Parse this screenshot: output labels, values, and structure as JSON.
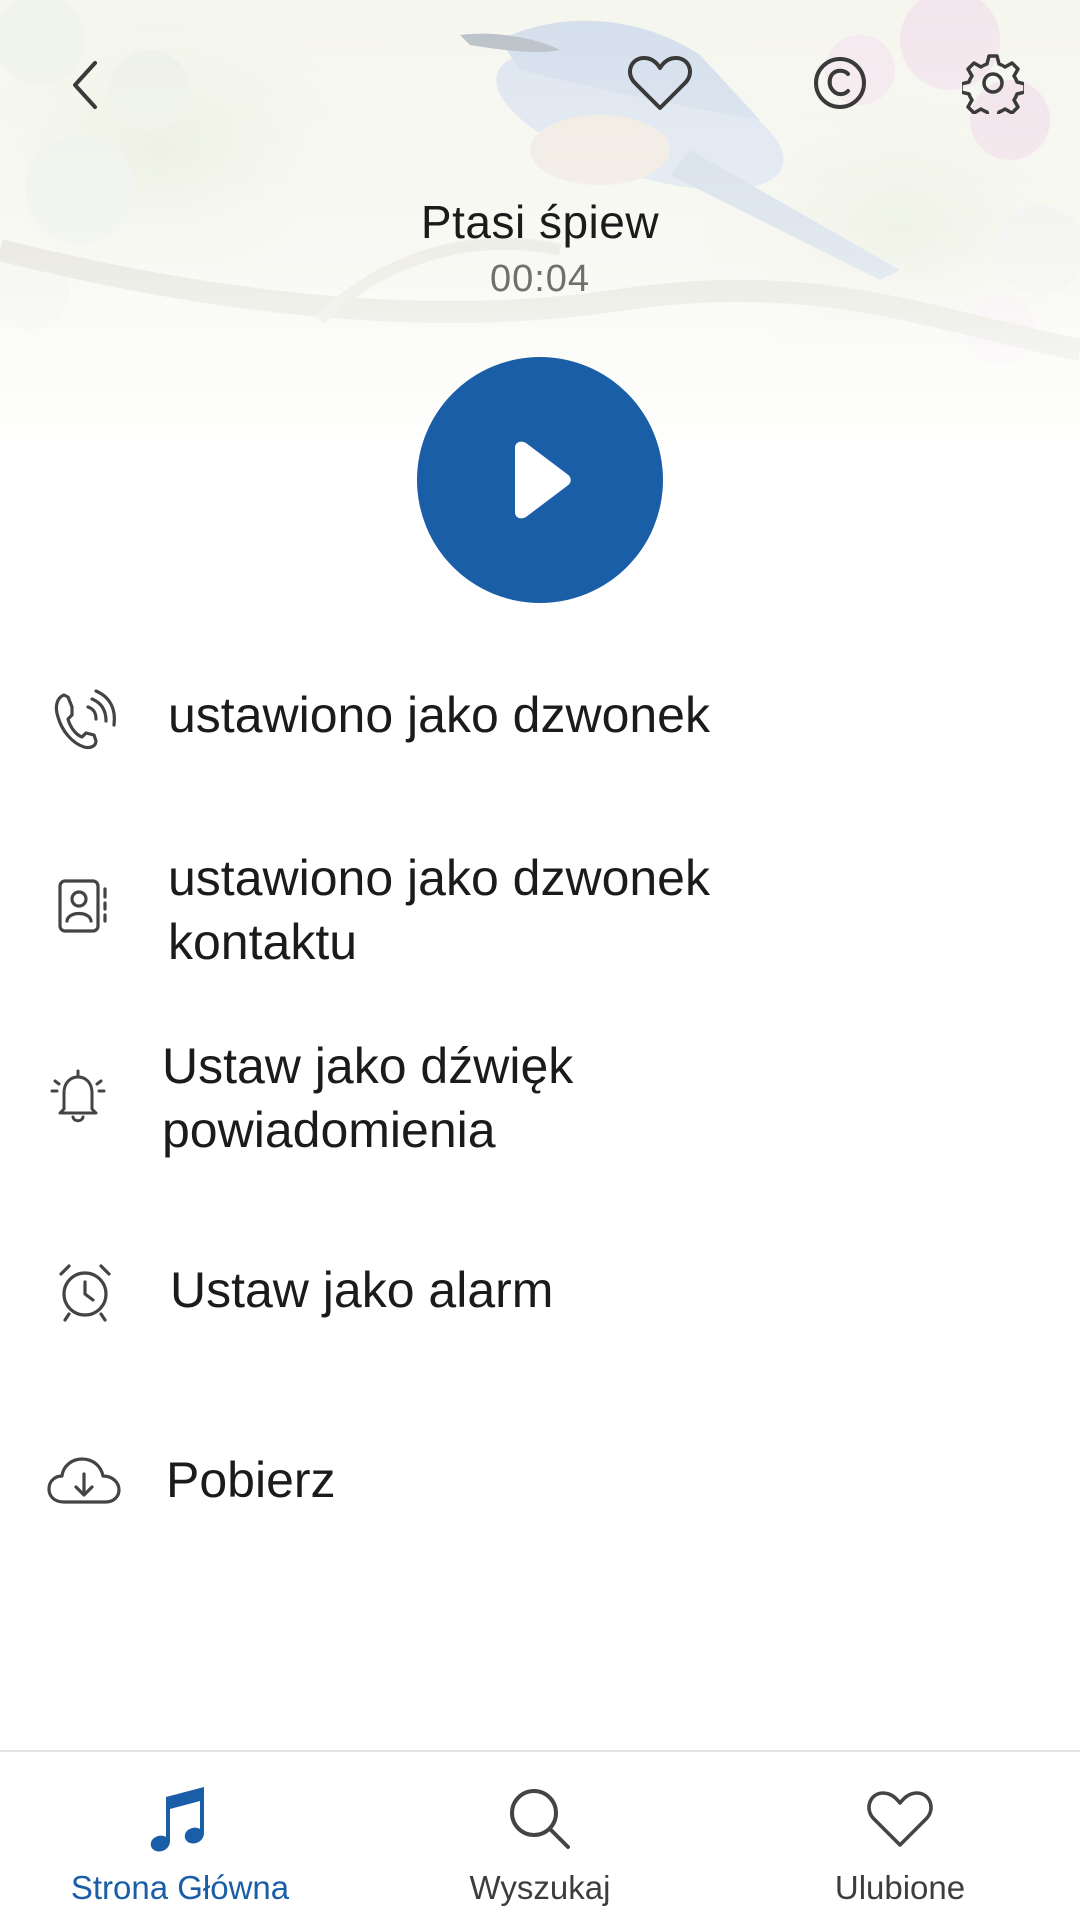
{
  "sound": {
    "title": "Ptasi śpiew",
    "duration": "00:04"
  },
  "header": {
    "icons": [
      "back-icon",
      "heart-icon",
      "copyright-icon",
      "gear-icon"
    ]
  },
  "actions": [
    {
      "label": "ustawiono jako dzwonek",
      "icon": "phone-ringing-icon"
    },
    {
      "label": "ustawiono jako dzwonek kontaktu",
      "icon": "contact-card-icon"
    },
    {
      "label": "Ustaw jako dźwięk powiadomienia",
      "icon": "bell-icon"
    },
    {
      "label": "Ustaw jako alarm",
      "icon": "alarm-clock-icon"
    },
    {
      "label": "Pobierz",
      "icon": "cloud-download-icon"
    }
  ],
  "tabs": [
    {
      "label": "Strona Główna",
      "icon": "music-note-icon",
      "active": true
    },
    {
      "label": "Wyszukaj",
      "icon": "search-icon",
      "active": false
    },
    {
      "label": "Ulubione",
      "icon": "heart-icon",
      "active": false
    }
  ],
  "colors": {
    "accent": "#1a5ea8",
    "text": "#1b1b1b",
    "muted": "#6f6f6f"
  }
}
